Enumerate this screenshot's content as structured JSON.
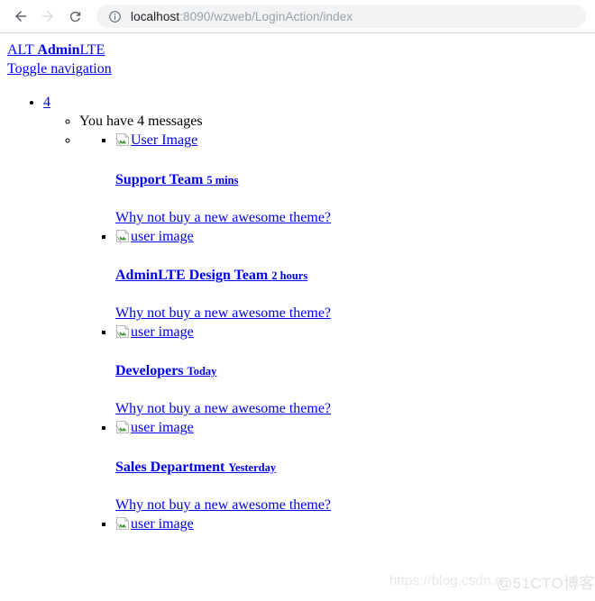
{
  "browser": {
    "back_label": "Back",
    "forward_label": "Forward",
    "reload_label": "Reload",
    "url_host": "localhost",
    "url_path": ":8090/wzweb/LoginAction/index",
    "url_full": "localhost:8090/wzweb/LoginAction/index",
    "site_info_tooltip": "View site information"
  },
  "page": {
    "brand": {
      "prefix": "ALT ",
      "bold": "Admin",
      "suffix": "LTE"
    },
    "toggle_navigation": "Toggle navigation",
    "notification_count": "4",
    "messages_header": "You have 4 messages",
    "messages": [
      {
        "image_alt": "User Image",
        "sender": "Support Team",
        "time": "5 mins",
        "body": "Why not buy a new awesome theme?"
      },
      {
        "image_alt": "user image",
        "sender": "AdminLTE Design Team",
        "time": "2 hours",
        "body": "Why not buy a new awesome theme?"
      },
      {
        "image_alt": "user image",
        "sender": "Developers",
        "time": "Today",
        "body": "Why not buy a new awesome theme?"
      },
      {
        "image_alt": "user image",
        "sender": "Sales Department",
        "time": "Yesterday",
        "body": "Why not buy a new awesome theme?"
      },
      {
        "image_alt": "user image",
        "sender": "",
        "time": "",
        "body": ""
      }
    ]
  },
  "watermarks": {
    "csdn": "https://blog.csdn.n",
    "cto": "@51CTO博客"
  },
  "colors": {
    "link": "#0000EE",
    "text": "#000000",
    "omnibox_bg": "#f1f3f4",
    "url_host": "#202124",
    "url_path": "#9aa0a6"
  }
}
